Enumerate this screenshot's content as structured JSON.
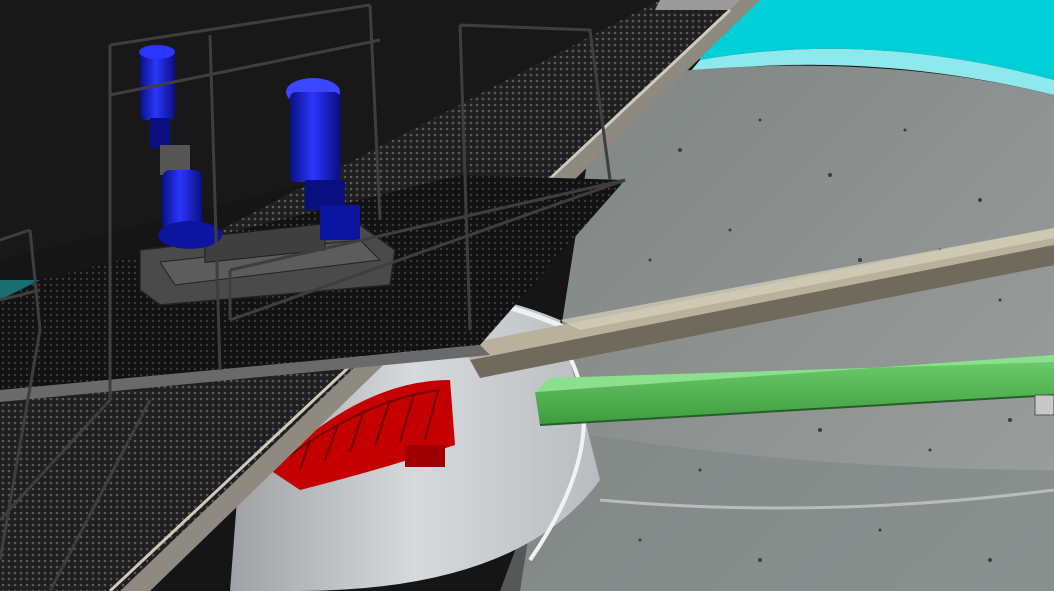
{
  "scene": {
    "colors": {
      "background_dark": "#141414",
      "tank_floor": "#8f9592",
      "tank_floor_light": "#a3a8a5",
      "tank_wall": "#c9cdcf",
      "tank_rim_cyan": "#00d8e0",
      "cyan_glow": "#2fe6e6",
      "walkway_grating": "#2a2a2a",
      "walkway_frame": "#9a9a9a",
      "handrail": "#3c3c3c",
      "motor_blue": "#1a24d8",
      "motor_blue_dark": "#0a0f80",
      "gearbox_grey": "#4a4a4a",
      "center_well_wall": "#d2d6da",
      "impeller_red": "#c80000",
      "impeller_red_dark": "#7a0000",
      "launder_green": "#4fbf4f",
      "launder_green_dark": "#2d7d2d",
      "scraper_arm": "#b5ad9a",
      "beam_edge": "#7b7565"
    },
    "components": [
      "walkway-bridge",
      "handrail",
      "drive-motor",
      "gearbox",
      "center-well",
      "impeller",
      "scraper-arm",
      "launder-trough",
      "tank-floor",
      "tank-rim"
    ]
  }
}
